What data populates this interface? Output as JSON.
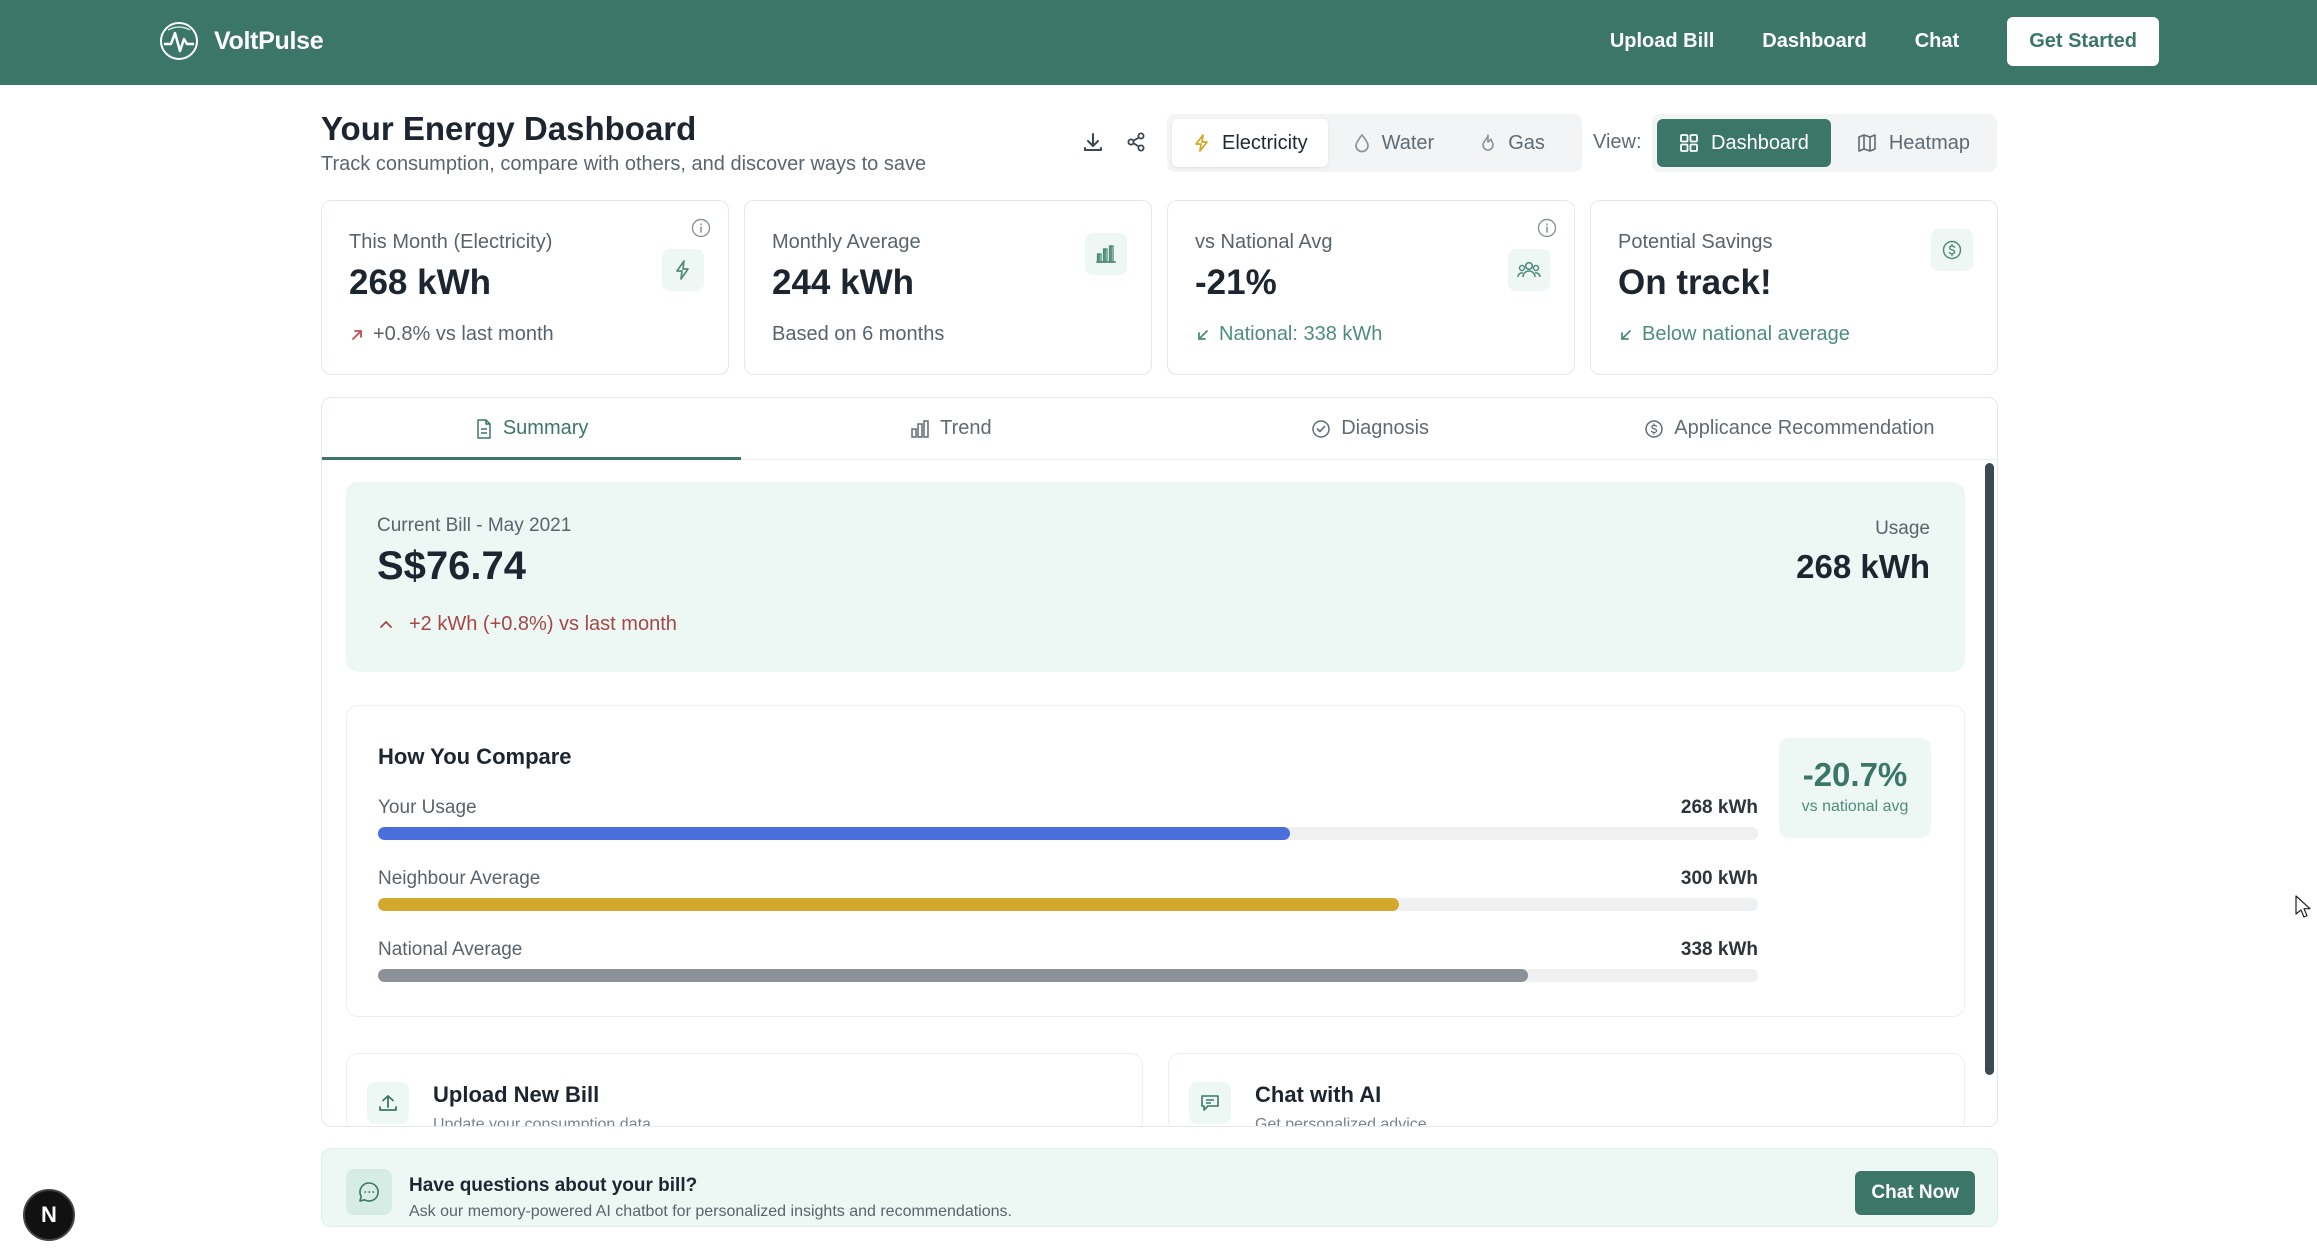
{
  "nav": {
    "brand": "VoltPulse",
    "links": [
      "Upload Bill",
      "Dashboard",
      "Chat"
    ],
    "cta": "Get Started"
  },
  "header": {
    "title": "Your Energy Dashboard",
    "subtitle": "Track consumption, compare with others, and discover ways to save",
    "utilities": [
      {
        "label": "Electricity",
        "icon": "lightning-icon",
        "active": true
      },
      {
        "label": "Water",
        "icon": "droplet-icon",
        "active": false
      },
      {
        "label": "Gas",
        "icon": "flame-icon",
        "active": false
      }
    ],
    "view_label": "View:",
    "views": [
      {
        "label": "Dashboard",
        "icon": "grid-icon",
        "active": true
      },
      {
        "label": "Heatmap",
        "icon": "map-icon",
        "active": false
      }
    ]
  },
  "stats": [
    {
      "label": "This Month (Electricity)",
      "value": "268 kWh",
      "note": "+0.8% vs last month",
      "icon": "lightning-icon"
    },
    {
      "label": "Monthly Average",
      "value": "244 kWh",
      "note": "Based on 6 months",
      "icon": "bar-chart-icon"
    },
    {
      "label": "vs National Avg",
      "value": "-21%",
      "note": "National: 338 kWh",
      "icon": "users-icon"
    },
    {
      "label": "Potential Savings",
      "value": "On track!",
      "note": "Below national average",
      "icon": "dollar-icon"
    }
  ],
  "tabs": [
    {
      "label": "Summary",
      "icon": "document-icon",
      "active": true
    },
    {
      "label": "Trend",
      "icon": "bar-chart-icon",
      "active": false
    },
    {
      "label": "Diagnosis",
      "icon": "check-circle-icon",
      "active": false
    },
    {
      "label": "Applicance Recommendation",
      "icon": "dollar-icon",
      "active": false
    }
  ],
  "bill": {
    "label": "Current Bill - May 2021",
    "amount": "S$76.74",
    "change": "+2 kWh (+0.8%) vs last month",
    "usage_label": "Usage",
    "usage_value": "268 kWh"
  },
  "compare": {
    "title": "How You Compare",
    "rows": [
      {
        "label": "Your Usage",
        "value": "268 kWh",
        "fraction": 0.661,
        "color": "#4a6fdc"
      },
      {
        "label": "Neighbour Average",
        "value": "300 kWh",
        "fraction": 0.74,
        "color": "#d3a82c"
      },
      {
        "label": "National Average",
        "value": "338 kWh",
        "fraction": 0.833,
        "color": "#8c9298"
      }
    ],
    "pct": "-20.7%",
    "pct_sub": "vs national avg"
  },
  "actions": [
    {
      "title": "Upload New Bill",
      "subtitle": "Update your consumption data",
      "icon": "upload-icon"
    },
    {
      "title": "Chat with AI",
      "subtitle": "Get personalized advice",
      "icon": "chat-icon"
    }
  ],
  "banner": {
    "title": "Have questions about your bill?",
    "subtitle": "Ask our memory-powered AI chatbot for personalized insights and recommendations.",
    "button": "Chat Now"
  },
  "fab_label": "N",
  "colors": {
    "brand": "#3b7668",
    "accent_bg": "#edf8f5"
  }
}
